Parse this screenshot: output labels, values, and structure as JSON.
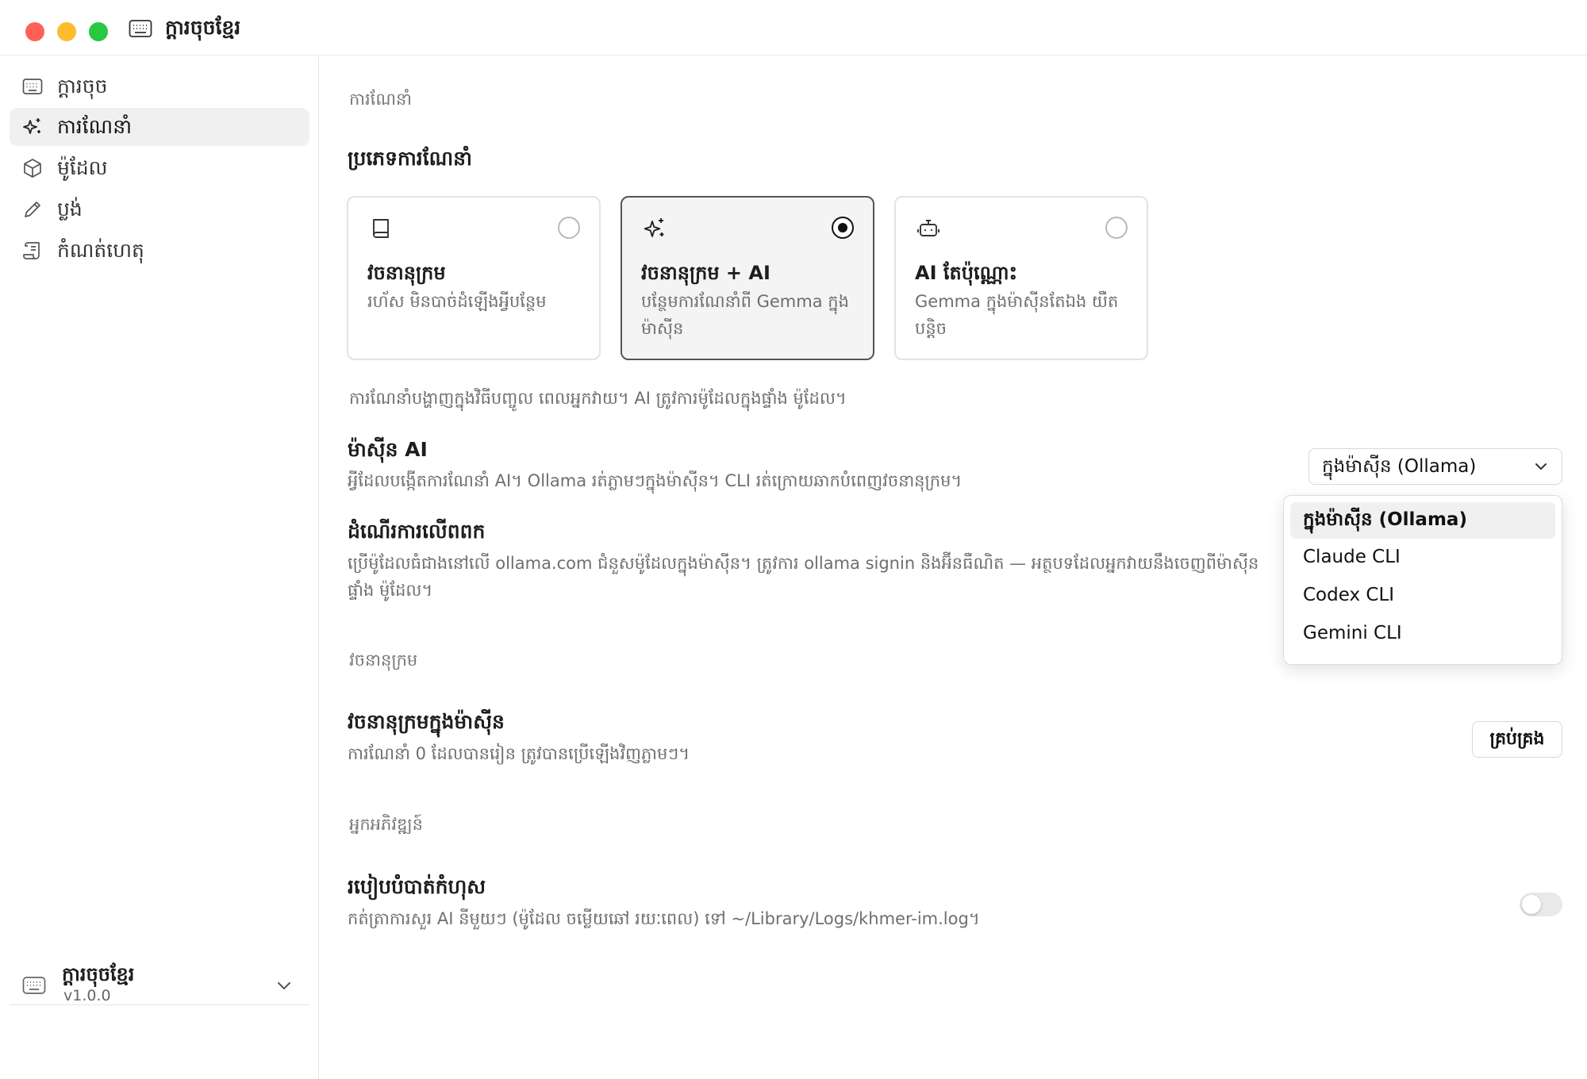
{
  "window": {
    "title": "ក្ដារចុចខ្មែរ"
  },
  "sidebar": {
    "items": [
      {
        "label": "ក្ដារចុច",
        "icon": "keyboard-icon"
      },
      {
        "label": "ការណែនាំ",
        "icon": "sparkles-icon"
      },
      {
        "label": "ម៉ូដែល",
        "icon": "cube-icon"
      },
      {
        "label": "ប្លង់",
        "icon": "pencil-icon"
      },
      {
        "label": "កំណត់ហេតុ",
        "icon": "scroll-icon"
      }
    ],
    "footer": {
      "name": "ក្ដារចុចខ្មែរ",
      "version": "v1.0.0"
    }
  },
  "main": {
    "section_suggestions": "ការណែនាំ",
    "suggestion_type_heading": "ប្រភេទការណែនាំ",
    "cards": [
      {
        "title": "វចនានុក្រម",
        "desc": "រហ័ស មិនបាច់ដំឡើងអ្វីបន្ថែម",
        "icon": "book-icon",
        "selected": false
      },
      {
        "title": "វចនានុក្រម + AI",
        "desc": "បន្ថែមការណែនាំពី Gemma ក្នុងម៉ាស៊ីន",
        "icon": "sparkles-icon",
        "selected": true
      },
      {
        "title": "AI តែប៉ុណ្ណោះ",
        "desc": "Gemma ក្នុងម៉ាស៊ីនតែឯង យឺតបន្តិច",
        "icon": "robot-icon",
        "selected": false
      }
    ],
    "suggestion_note": "ការណែនាំបង្ហាញក្នុងវិធីបញ្ចូល ពេលអ្នកវាយ។ AI ត្រូវការម៉ូដែលក្នុងផ្ទាំង ម៉ូដែល។",
    "ai_engine": {
      "heading": "ម៉ាស៊ីន AI",
      "desc": "អ្វីដែលបង្កើតការណែនាំ AI។ Ollama រត់ភ្លាមៗក្នុងម៉ាស៊ីន។ CLI រត់ក្រោយឆាកបំពេញវចនានុក្រម។",
      "selected": "ក្នុងម៉ាស៊ីន (Ollama)",
      "options": [
        "ក្នុងម៉ាស៊ីន (Ollama)",
        "Claude CLI",
        "Codex CLI",
        "Gemini CLI"
      ]
    },
    "cloud": {
      "heading": "ដំណើរការលើពពក",
      "desc_line1": "ប្រើម៉ូដែលធំជាងនៅលើ ollama.com ជំនួសម៉ូដែលក្នុងម៉ាស៊ីន។ ត្រូវការ ollama signin និងអ៊ីនធឺណិត — អត្ថបទដែលអ្នកវាយនឹងចេញពីម៉ាស៊ីន",
      "desc_line2": "ផ្ទាំង ម៉ូដែល។"
    },
    "section_dictionary": "វចនានុក្រម",
    "local_dictionary": {
      "heading": "វចនានុក្រមក្នុងម៉ាស៊ីន",
      "desc": "ការណែនាំ 0 ដែលបានរៀន ត្រូវបានប្រើឡើងវិញភ្លាមៗ។",
      "manage_label": "គ្រប់គ្រង"
    },
    "section_developer": "អ្នកអភិវឌ្ឍន៍",
    "debug": {
      "heading": "របៀបបំបាត់កំហុស",
      "desc": "កត់ត្រាការសួរ AI នីមួយៗ (ម៉ូដែល ចម្លើយឆៅ រយៈពេល) ទៅ ~/Library/Logs/khmer-im.log។",
      "enabled": false
    }
  },
  "colors": {
    "close": "#ff5f57",
    "minimize": "#febc2e",
    "maximize": "#28c840",
    "active_bg": "#f0f0f0"
  }
}
